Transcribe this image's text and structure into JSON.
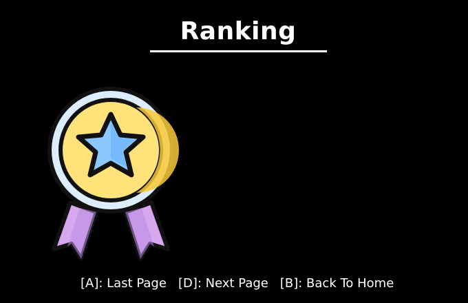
{
  "screen": {
    "title": "Ranking",
    "emblem_icon": "medal-star-icon",
    "colors": {
      "background": "#000000",
      "text": "#ffffff",
      "medal_outer_ring": "#dceefe",
      "medal_face": "#ffe27a",
      "medal_face_shade": "#f8c935",
      "star": "#8ac8ff",
      "star_shade": "#5aa8f5",
      "ribbon": "#d6a8f0",
      "ribbon_shade": "#b98ae0",
      "outline": "#111111"
    }
  },
  "controls": {
    "last_page": "[A]: Last Page",
    "next_page": "[D]: Next Page",
    "back_home": "[B]: Back To Home"
  }
}
